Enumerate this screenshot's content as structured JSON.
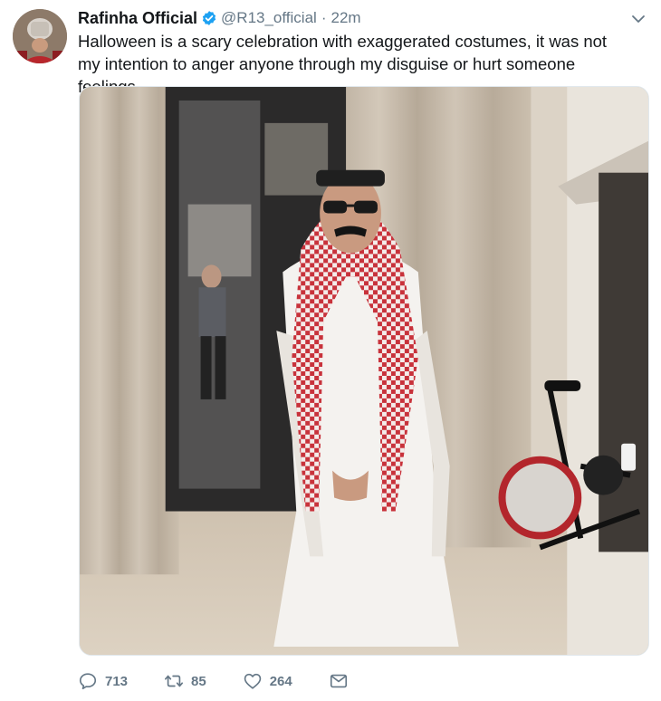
{
  "tweet": {
    "author_name": "Rafinha Official",
    "handle": "@R13_official",
    "separator": "·",
    "time": "22m",
    "text": "Halloween is a scary celebration with exaggerated costumes, it was not my intention to anger anyone through my disguise or hurt someone feelings.",
    "verified": true
  },
  "actions": {
    "replies": "713",
    "retweets": "85",
    "likes": "264"
  },
  "icons": {
    "verified": "verified-badge-icon",
    "caret": "chevron-down-icon",
    "reply": "reply-icon",
    "retweet": "retweet-icon",
    "like": "heart-icon",
    "message": "envelope-icon"
  },
  "colors": {
    "text": "#14171a",
    "secondary": "#657786",
    "verified": "#1da1f2"
  }
}
